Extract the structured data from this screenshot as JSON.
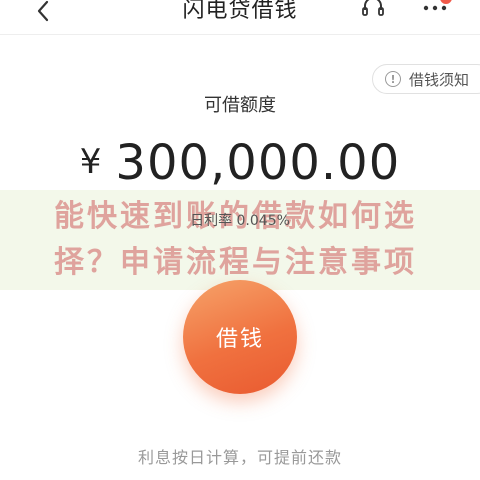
{
  "header": {
    "title": "闪电贷借钱",
    "icons": {
      "back": "back-chevron-icon",
      "support": "customer-service-icon",
      "more": "more-icon"
    },
    "badge_color": "#f15a4a"
  },
  "notice": {
    "icon": "info-icon",
    "icon_glyph": "!",
    "label": "借钱须知"
  },
  "amount": {
    "label": "可借额度",
    "currency": "¥",
    "value": "300,000.00"
  },
  "rate": {
    "text": "日利率 0.045%"
  },
  "watermark": {
    "text": "能快速到账的借款如何选择？申请流程与注意事项"
  },
  "borrow_button": {
    "label": "借钱",
    "color_start": "#f6a36a",
    "color_end": "#e95a30"
  },
  "footer": {
    "note": "利息按日计算，可提前还款"
  }
}
